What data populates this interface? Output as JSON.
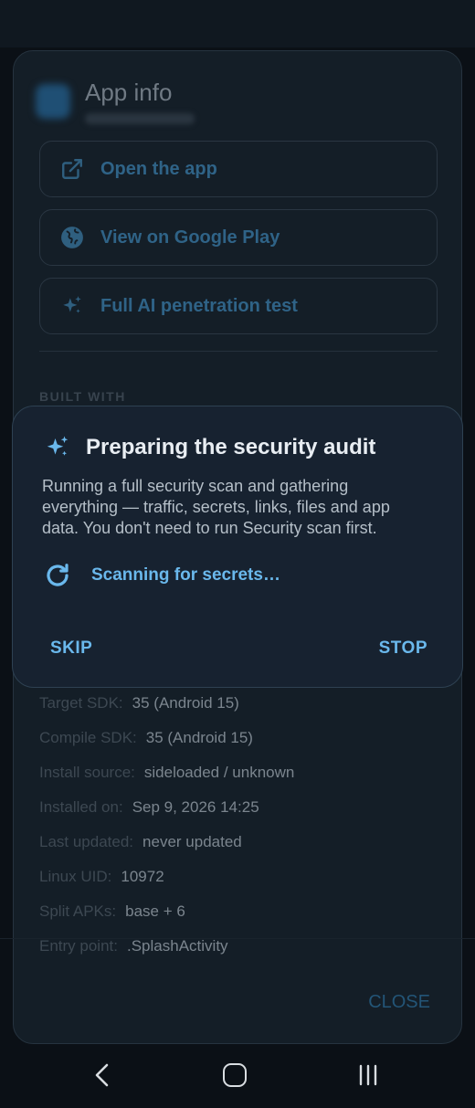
{
  "app_info": {
    "title": "App info",
    "actions": [
      {
        "label": "Open the app",
        "icon": "open-external-icon"
      },
      {
        "label": "View on Google Play",
        "icon": "globe-icon"
      },
      {
        "label": "Full AI penetration test",
        "icon": "sparkle-icon"
      }
    ],
    "section_label": "BUILT WITH",
    "details": [
      {
        "key": "Target SDK:",
        "value": "35 (Android 15)"
      },
      {
        "key": "Compile SDK:",
        "value": "35 (Android 15)"
      },
      {
        "key": "Install source:",
        "value": "sideloaded / unknown"
      },
      {
        "key": "Installed on:",
        "value": "Sep 9, 2026 14:25"
      },
      {
        "key": "Last updated:",
        "value": "never updated"
      },
      {
        "key": "Linux UID:",
        "value": "10972"
      },
      {
        "key": "Split APKs:",
        "value": "base + 6"
      },
      {
        "key": "Entry point:",
        "value": ".SplashActivity"
      }
    ],
    "close_label": "CLOSE"
  },
  "dialog": {
    "title": "Preparing the security audit",
    "body": "Running a full security scan and gathering everything — traffic, secrets, links, files and app data. You don't need to run Security scan first.",
    "progress_text": "Scanning for secrets…",
    "skip_label": "SKIP",
    "stop_label": "STOP"
  },
  "colors": {
    "accent": "#6ab8ec",
    "dialog_bg": "#172230",
    "sheet_bg": "#141e27"
  }
}
